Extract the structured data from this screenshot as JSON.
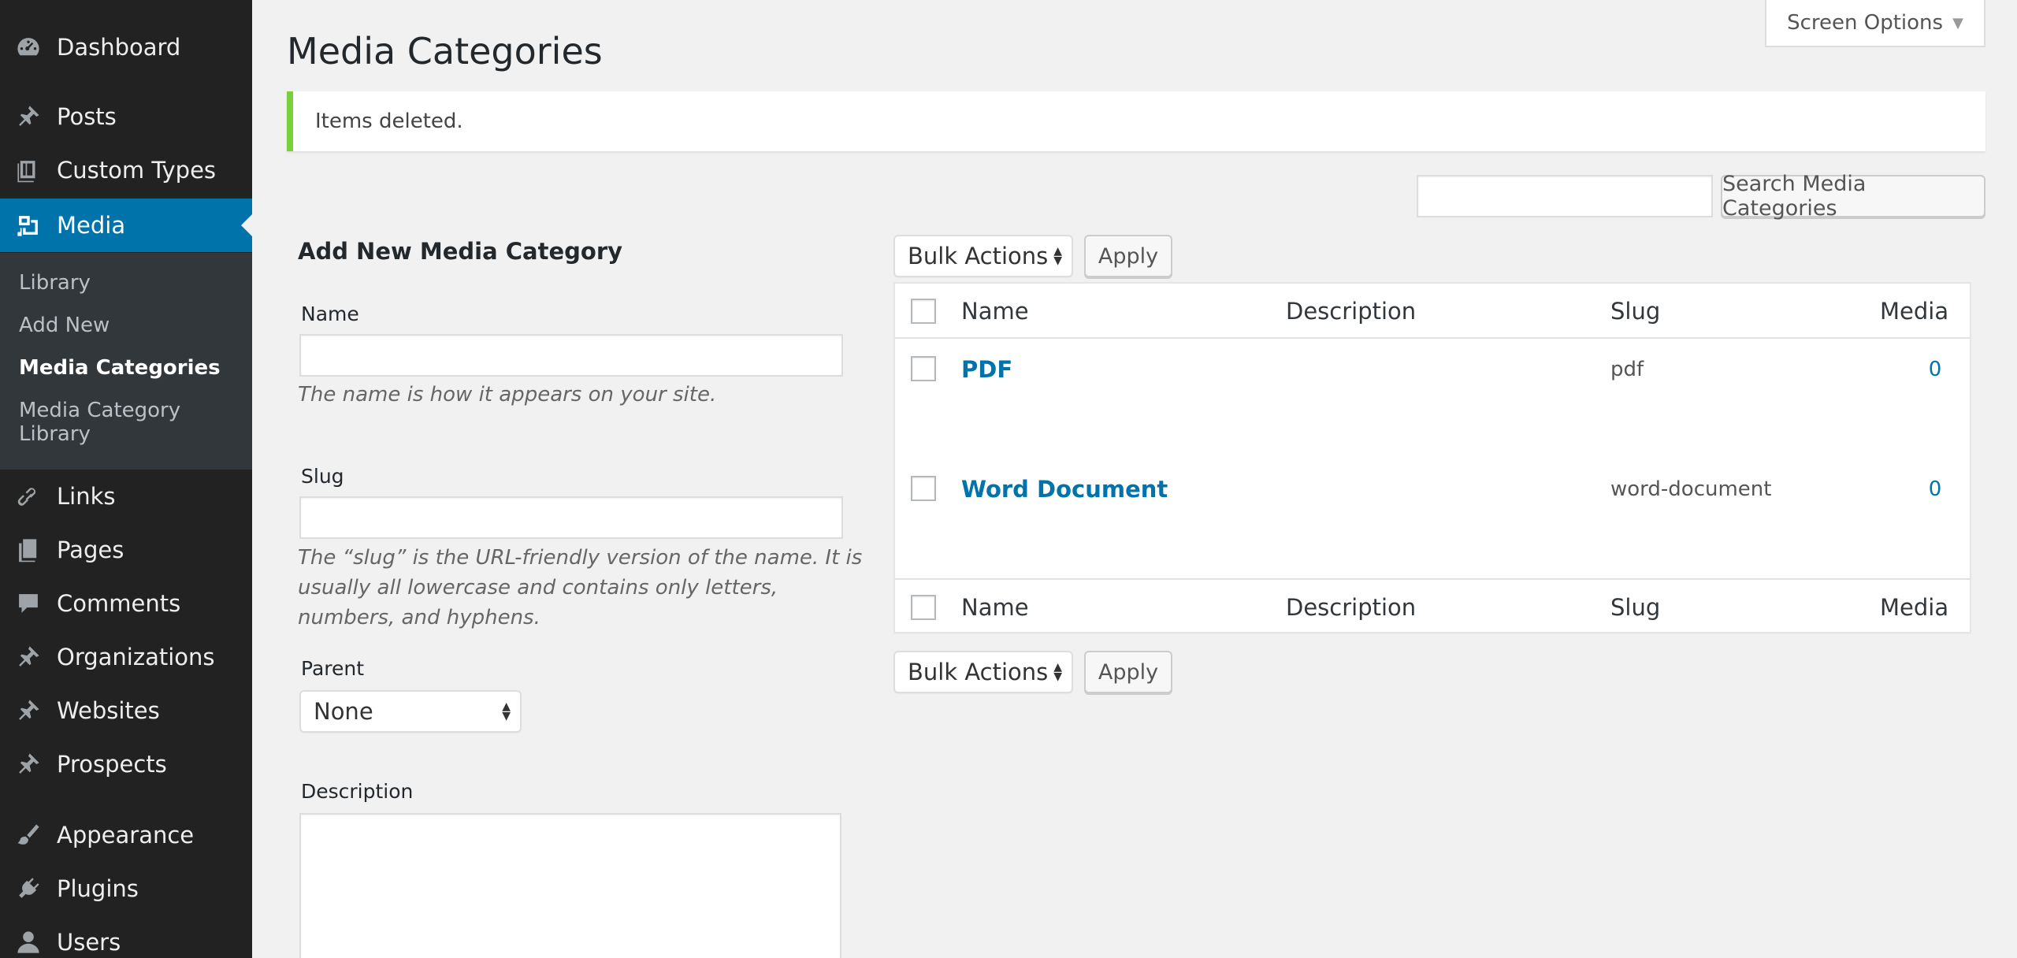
{
  "sidebar": {
    "items": [
      {
        "label": "Dashboard",
        "icon": "dashboard-icon"
      },
      {
        "label": "Posts",
        "icon": "pushpin-icon"
      },
      {
        "label": "Custom Types",
        "icon": "custom-types-icon"
      },
      {
        "label": "Media",
        "icon": "media-icon"
      },
      {
        "label": "Links",
        "icon": "link-icon"
      },
      {
        "label": "Pages",
        "icon": "pages-icon"
      },
      {
        "label": "Comments",
        "icon": "comment-icon"
      },
      {
        "label": "Organizations",
        "icon": "pushpin-icon"
      },
      {
        "label": "Websites",
        "icon": "pushpin-icon"
      },
      {
        "label": "Prospects",
        "icon": "pushpin-icon"
      },
      {
        "label": "Appearance",
        "icon": "paintbrush-icon"
      },
      {
        "label": "Plugins",
        "icon": "plugin-icon"
      },
      {
        "label": "Users",
        "icon": "user-icon"
      }
    ],
    "submenu": [
      "Library",
      "Add New",
      "Media Categories",
      "Media Category",
      "Library"
    ]
  },
  "header": {
    "title": "Media Categories",
    "screen_options": "Screen Options"
  },
  "notice": "Items deleted.",
  "search": {
    "button": "Search Media Categories",
    "value": ""
  },
  "form": {
    "title": "Add New Media Category",
    "name_label": "Name",
    "name_help": "The name is how it appears on your site.",
    "slug_label": "Slug",
    "slug_help": "The “slug” is the URL-friendly version of the name. It is usually all lowercase and contains only letters, numbers, and hyphens.",
    "parent_label": "Parent",
    "parent_value": "None",
    "description_label": "Description"
  },
  "table": {
    "bulk_actions": "Bulk Actions",
    "apply": "Apply",
    "columns": [
      "Name",
      "Description",
      "Slug",
      "Media"
    ],
    "rows": [
      {
        "name": "PDF",
        "description": "",
        "slug": "pdf",
        "count": "0"
      },
      {
        "name": "Word Document",
        "description": "",
        "slug": "word-document",
        "count": "0"
      }
    ]
  }
}
